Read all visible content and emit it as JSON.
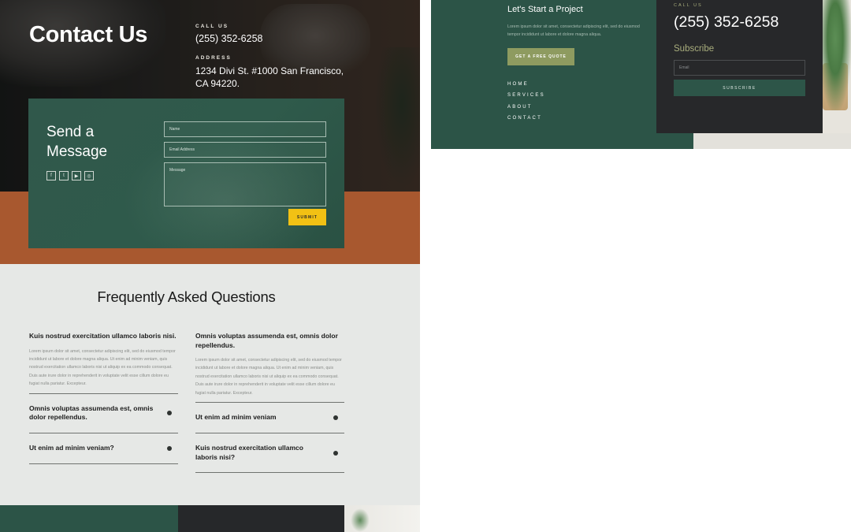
{
  "contact_page": {
    "title": "Contact Us",
    "call_label": "CALL US",
    "phone": "(255) 352-6258",
    "address_label": "ADDRESS",
    "address": "1234 Divi St. #1000 San Francisco, CA 94220."
  },
  "message_form": {
    "title": "Send a Message",
    "social_icons": [
      "facebook-icon",
      "twitter-icon",
      "youtube-icon",
      "instagram-icon"
    ],
    "social_glyphs": [
      "f",
      "t",
      "▶",
      "◎"
    ],
    "name_placeholder": "Name",
    "email_placeholder": "Email Address",
    "message_placeholder": "Message",
    "submit_label": "SUBMIT"
  },
  "faq": {
    "title": "Frequently Asked Questions",
    "left": {
      "open": {
        "question": "Kuis nostrud exercitation ullamco laboris nisi.",
        "answer": "Lorem ipsum dolor sit amet, consectetur adipiscing elit, sed do eiusmod tempor incididunt ut labore et dolore magna aliqua. Ut enim ad minim veniam, quis nostrud exercitation ullamco laboris nisi ut aliquip ex ea commodo consequat. Duis aute irure dolor in reprehenderit in voluptate velit esse cillum dolore eu fugiat nulla pariatur. Excepteur."
      },
      "collapsed": [
        "Omnis voluptas assumenda est, omnis dolor repellendus.",
        "Ut enim ad minim veniam?"
      ]
    },
    "right": {
      "open": {
        "question": "Omnis voluptas assumenda est, omnis dolor repellendus.",
        "answer": "Lorem ipsum dolor sit amet, consectetur adipiscing elit, sed do eiusmod tempor incididunt ut labore et dolore magna aliqua. Ut enim ad minim veniam, quis nostrud exercitation ullamco laboris nisi ut aliquip ex ea commodo consequat. Duis aute irure dolor in reprehenderit in voluptate velit esse cillum dolore eu fugiat nulla pariatur. Excepteur."
      },
      "collapsed": [
        "Ut enim ad minim veniam",
        "Kuis nostrud exercitation ullamco laboris nisi?"
      ]
    }
  },
  "footer": {
    "project_title": "Let's Start a Project",
    "project_text": "Lorem ipsum dolor sit amet, consectetur adipiscing elit, sed do eiusmod tempor incididunt ut labore et dolore magna aliqua.",
    "quote_button": "GET A FREE QUOTE",
    "nav": [
      "HOME",
      "SERVICES",
      "ABOUT",
      "CONTACT"
    ],
    "call_label": "CALL US",
    "phone": "(255) 352-6258",
    "subscribe_title": "Subscribe",
    "email_placeholder": "Email",
    "subscribe_button": "SUBSCRIBE"
  },
  "colors": {
    "forest_green": "#2c5447",
    "terracotta": "#a8582f",
    "submit_yellow": "#f2c114",
    "olive": "#8e9b60",
    "charcoal": "#27282a",
    "faq_background": "#e6e8e6"
  }
}
